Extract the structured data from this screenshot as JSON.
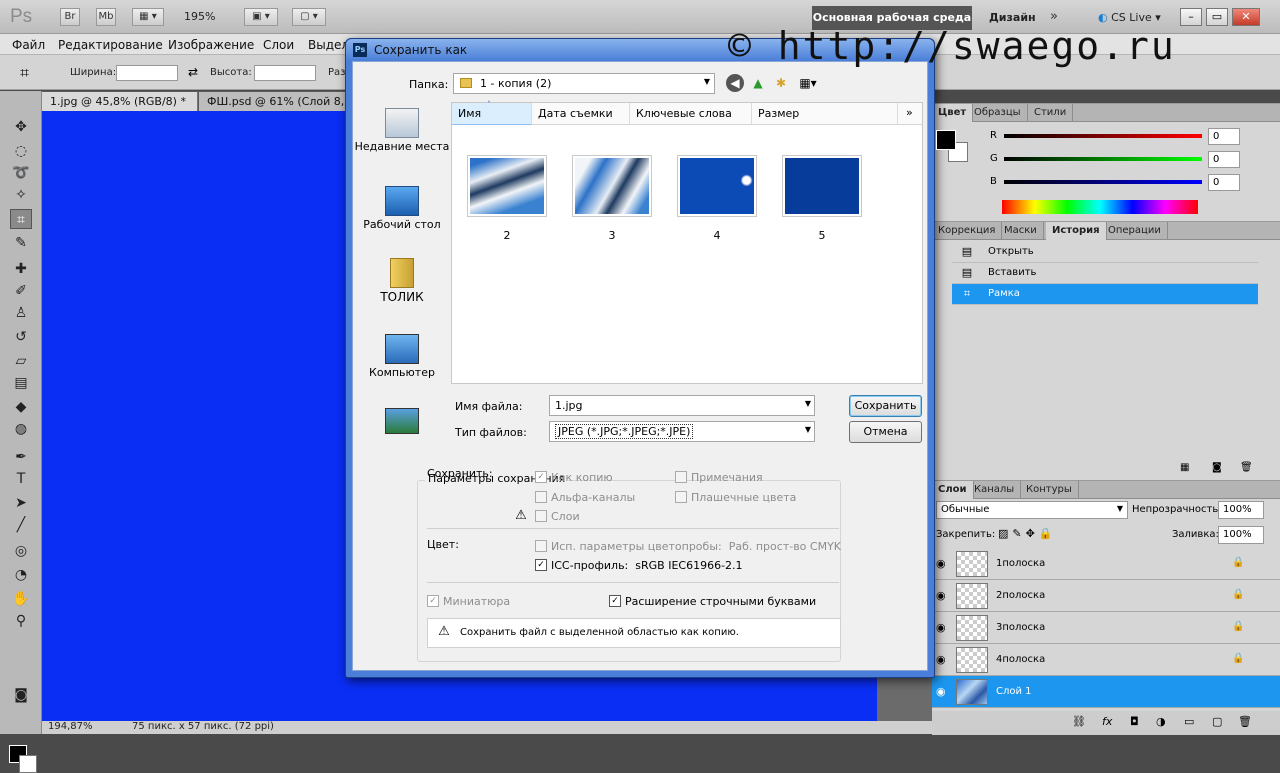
{
  "app": {
    "logo": "Ps",
    "bridge": "Br",
    "minibridge": "Mb",
    "zoom": "195%",
    "workspace_main": "Основная рабочая среда",
    "workspace_design": "Дизайн",
    "cslive": "CS Live",
    "watermark": "© http://swaego.ru",
    "win_min": "–",
    "win_max": "▭",
    "win_close": "✕"
  },
  "menu": [
    "Файл",
    "Редактирование",
    "Изображение",
    "Слои",
    "Выдел"
  ],
  "options": {
    "width_label": "Ширина:",
    "height_label": "Высота:",
    "res_label": "Раз"
  },
  "doc_tabs": [
    "1.jpg @ 45,8% (RGB/8) *",
    "ФШ.psd @ 61% (Слой 8, R"
  ],
  "status": {
    "zoom": "194,87%",
    "info": "75 пикс. x 57 пикс. (72 ppi)"
  },
  "color_panel": {
    "tabs": [
      "Цвет",
      "Образцы",
      "Стили"
    ],
    "r_label": "R",
    "g_label": "G",
    "b_label": "B",
    "r": "0",
    "g": "0",
    "b": "0"
  },
  "history_panel": {
    "tabs": [
      "Коррекция",
      "Маски",
      "История",
      "Операции"
    ],
    "items": [
      "Открыть",
      "Вставить",
      "Рамка"
    ]
  },
  "layers_panel": {
    "tabs": [
      "Слои",
      "Каналы",
      "Контуры"
    ],
    "blend_mode": "Обычные",
    "opacity_label": "Непрозрачность:",
    "opacity": "100%",
    "lock_label": "Закрепить:",
    "fill_label": "Заливка:",
    "fill": "100%",
    "layers": [
      "1полоска",
      "2полоска",
      "3полоска",
      "4полоска",
      "Слой 1"
    ]
  },
  "dialog": {
    "title": "Сохранить как",
    "folder_label": "Папка:",
    "folder": "1 - копия (2)",
    "places": [
      "Недавние места",
      "Рабочий стол",
      "ТОЛИК",
      "Компьютер"
    ],
    "columns": [
      "Имя",
      "Дата съемки",
      "Ключевые слова",
      "Размер"
    ],
    "files": [
      "2",
      "3",
      "4",
      "5"
    ],
    "filename_label": "Имя файла:",
    "filename": "1.jpg",
    "filetype_label": "Тип файлов:",
    "filetype": "JPEG (*.JPG;*.JPEG;*.JPE)",
    "save_button": "Сохранить",
    "cancel_button": "Отмена",
    "params_title": "Параметры сохранения",
    "save_label": "Сохранить:",
    "as_copy": "Как копию",
    "notes": "Примечания",
    "alpha": "Альфа-каналы",
    "spot": "Плашечные цвета",
    "layers": "Слои",
    "color_label": "Цвет:",
    "proof": "Исп. параметры цветопробы:",
    "proof_value": "Раб. прост-во CMYK",
    "icc": "ICC-профиль:",
    "icc_value": "sRGB IEC61966-2.1",
    "thumbnail": "Миниатюра",
    "lowercase_ext": "Расширение строчными буквами",
    "warning_note": "Сохранить файл с выделенной областью как копию."
  }
}
